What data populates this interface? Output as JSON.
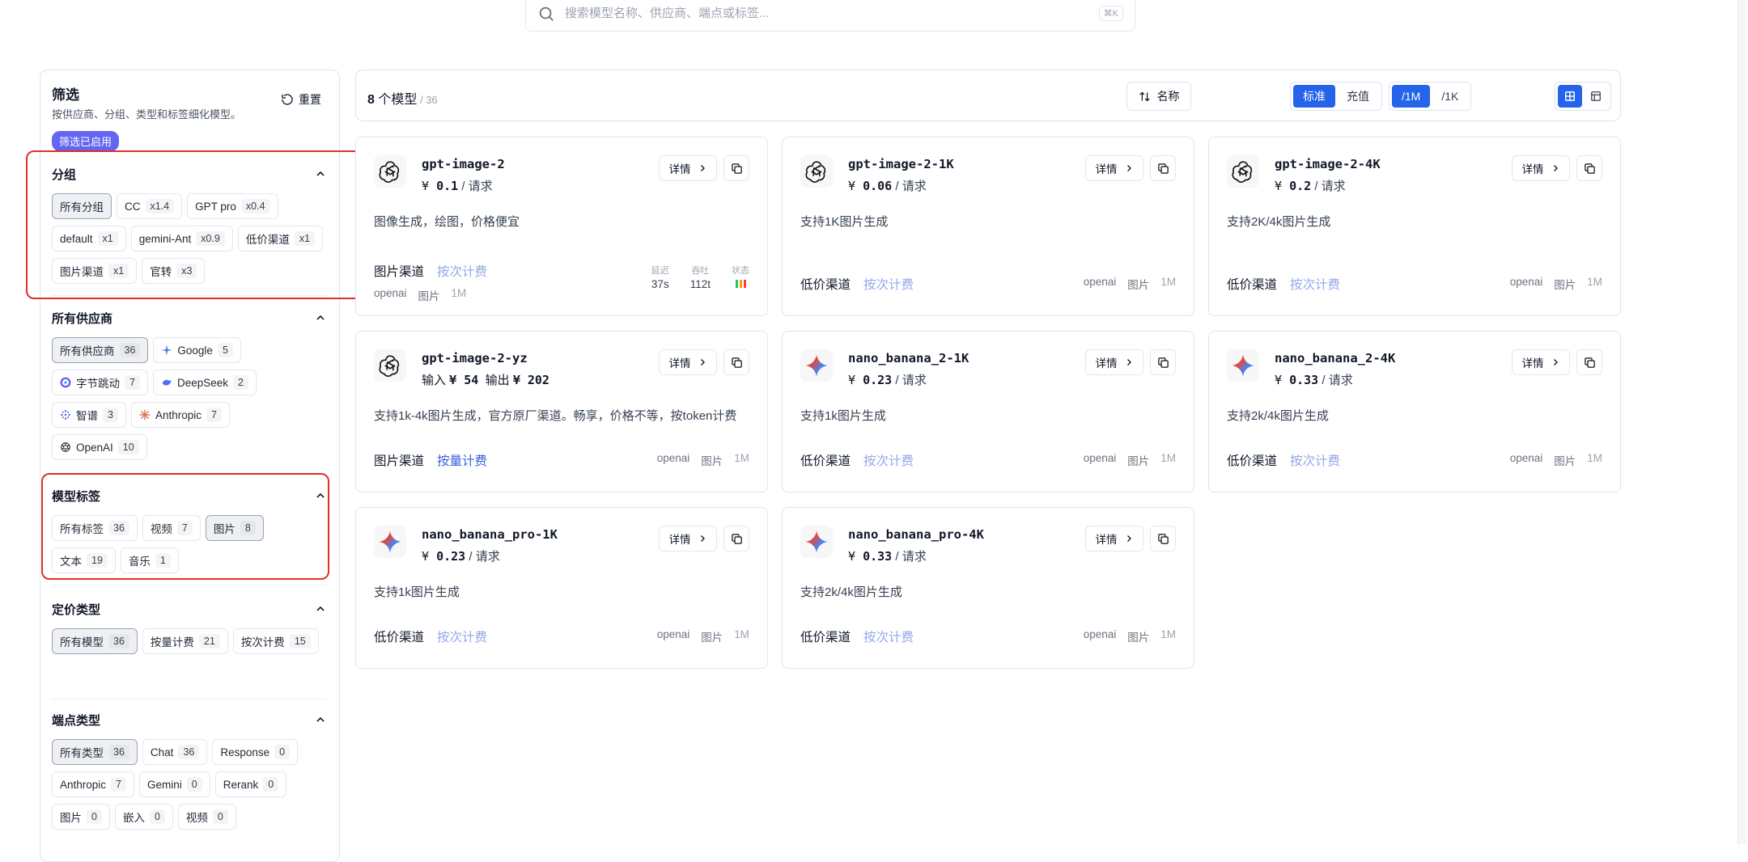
{
  "search": {
    "placeholder": "搜索模型名称、供应商、端点或标签...",
    "shortcut": "⌘K"
  },
  "sidebar": {
    "title": "筛选",
    "desc": "按供应商、分组、类型和标签细化模型。",
    "reset": "重置",
    "active_badge": "筛选已启用",
    "groups": {
      "title": "分组",
      "items": [
        {
          "label": "所有分组",
          "count": "",
          "selected": true
        },
        {
          "label": "CC",
          "count": "x1.4"
        },
        {
          "label": "GPT pro",
          "count": "x0.4"
        },
        {
          "label": "default",
          "count": "x1"
        },
        {
          "label": "gemini-Ant",
          "count": "x0.9"
        },
        {
          "label": "低价渠道",
          "count": "x1"
        },
        {
          "label": "图片渠道",
          "count": "x1"
        },
        {
          "label": "官转",
          "count": "x3"
        }
      ]
    },
    "vendors": {
      "title": "所有供应商",
      "items": [
        {
          "label": "所有供应商",
          "count": "36",
          "selected": true
        },
        {
          "label": "Google",
          "count": "5",
          "icon": "google-icon"
        },
        {
          "label": "字节跳动",
          "count": "7",
          "icon": "bytedance-icon"
        },
        {
          "label": "DeepSeek",
          "count": "2",
          "icon": "deepseek-icon"
        },
        {
          "label": "智谱",
          "count": "3",
          "icon": "zhipu-icon"
        },
        {
          "label": "Anthropic",
          "count": "7",
          "icon": "anthropic-icon"
        },
        {
          "label": "OpenAI",
          "count": "10",
          "icon": "openai-icon"
        }
      ]
    },
    "tags": {
      "title": "模型标签",
      "items": [
        {
          "label": "所有标签",
          "count": "36"
        },
        {
          "label": "视频",
          "count": "7"
        },
        {
          "label": "图片",
          "count": "8",
          "selected": true
        },
        {
          "label": "文本",
          "count": "19"
        },
        {
          "label": "音乐",
          "count": "1"
        }
      ]
    },
    "pricing": {
      "title": "定价类型",
      "items": [
        {
          "label": "所有模型",
          "count": "36",
          "selected": true
        },
        {
          "label": "按量计费",
          "count": "21"
        },
        {
          "label": "按次计费",
          "count": "15"
        }
      ]
    },
    "endpoints": {
      "title": "端点类型",
      "items": [
        {
          "label": "所有类型",
          "count": "36",
          "selected": true
        },
        {
          "label": "Chat",
          "count": "36"
        },
        {
          "label": "Response",
          "count": "0"
        },
        {
          "label": "Anthropic",
          "count": "7"
        },
        {
          "label": "Gemini",
          "count": "0"
        },
        {
          "label": "Rerank",
          "count": "0"
        },
        {
          "label": "图片",
          "count": "0"
        },
        {
          "label": "嵌入",
          "count": "0"
        },
        {
          "label": "视频",
          "count": "0"
        }
      ]
    }
  },
  "toolbar": {
    "count_num": "8",
    "count_label": " 个模型",
    "count_total": " / 36",
    "price_mode": [
      "标准",
      "充值"
    ],
    "unit_mode": [
      "/1M",
      "/1K"
    ],
    "sort_label": "名称"
  },
  "cards": [
    {
      "name": "gpt-image-2",
      "price_prefix": "¥ ",
      "price": "0.1",
      "unit": " / 请求",
      "desc": "图像生成，绘图，价格便宜",
      "group": "图片渠道",
      "billing": "按次计费",
      "vendor": "openai",
      "tag": "图片",
      "ctx": "1M",
      "logo": "openai-logo",
      "stats": {
        "latency_label": "延迟",
        "latency": "37s",
        "tput_label": "吞吐",
        "tput": "112t",
        "status_label": "状态"
      }
    },
    {
      "name": "gpt-image-2-1K",
      "price_prefix": "¥ ",
      "price": "0.06",
      "unit": " / 请求",
      "desc": "支持1K图片生成",
      "group": "低价渠道",
      "billing": "按次计费",
      "vendor": "openai",
      "tag": "图片",
      "ctx": "1M",
      "logo": "openai-logo"
    },
    {
      "name": "gpt-image-2-4K",
      "price_prefix": "¥ ",
      "price": "0.2",
      "unit": " / 请求",
      "desc": "支持2K/4k图片生成",
      "group": "低价渠道",
      "billing": "按次计费",
      "vendor": "openai",
      "tag": "图片",
      "ctx": "1M",
      "logo": "openai-logo"
    },
    {
      "name": "gpt-image-2-yz",
      "price_in_label": "输入 ",
      "price_in": "¥ 54",
      "price_out_label": "  输出 ",
      "price_out": "¥ 202",
      "desc": "支持1k-4k图片生成，官方原厂渠道。畅享，价格不等，按token计费",
      "group": "图片渠道",
      "billing": "按量计费",
      "vendor": "openai",
      "tag": "图片",
      "ctx": "1M",
      "logo": "openai-logo"
    },
    {
      "name": "nano_banana_2-1K",
      "price_prefix": "¥ ",
      "price": "0.23",
      "unit": " / 请求",
      "desc": "支持1k图片生成",
      "group": "低价渠道",
      "billing": "按次计费",
      "vendor": "openai",
      "tag": "图片",
      "ctx": "1M",
      "logo": "gemini-logo"
    },
    {
      "name": "nano_banana_2-4K",
      "price_prefix": "¥ ",
      "price": "0.33",
      "unit": " / 请求",
      "desc": "支持2k/4k图片生成",
      "group": "低价渠道",
      "billing": "按次计费",
      "vendor": "openai",
      "tag": "图片",
      "ctx": "1M",
      "logo": "gemini-logo"
    },
    {
      "name": "nano_banana_pro-1K",
      "price_prefix": "¥ ",
      "price": "0.23",
      "unit": " / 请求",
      "desc": "支持1k图片生成",
      "group": "低价渠道",
      "billing": "按次计费",
      "vendor": "openai",
      "tag": "图片",
      "ctx": "1M",
      "logo": "gemini-logo"
    },
    {
      "name": "nano_banana_pro-4K",
      "price_prefix": "¥ ",
      "price": "0.33",
      "unit": " / 请求",
      "desc": "支持2k/4k图片生成",
      "group": "低价渠道",
      "billing": "按次计费",
      "vendor": "openai",
      "tag": "图片",
      "ctx": "1M",
      "logo": "gemini-logo"
    }
  ],
  "card_actions": {
    "detail": "详情"
  },
  "colors": {
    "accent": "#2563eb",
    "highlight": "#e0302b",
    "badge": "#6366f1"
  }
}
